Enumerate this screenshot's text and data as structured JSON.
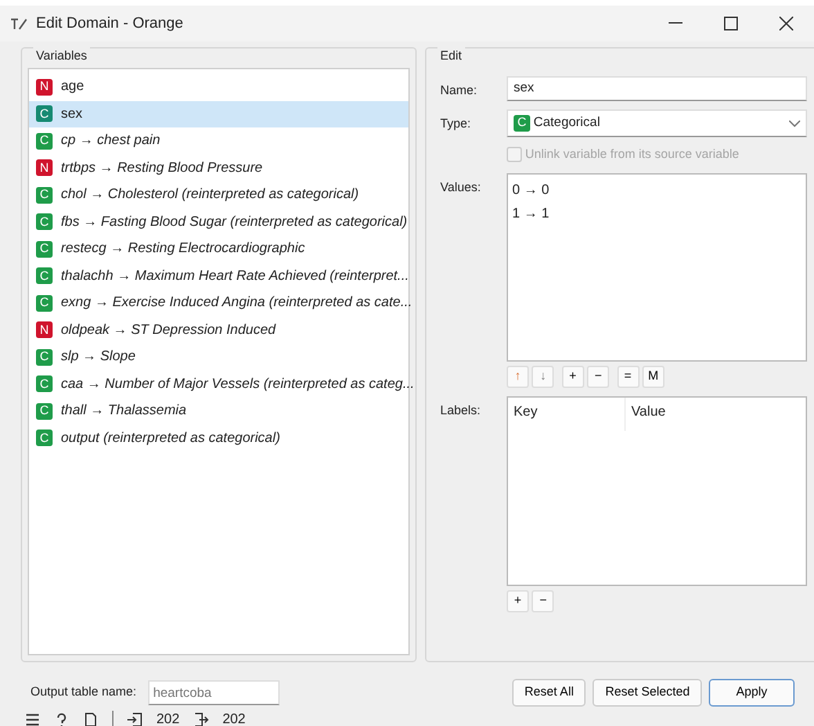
{
  "window": {
    "title": "Edit Domain - Orange"
  },
  "variables": {
    "title": "Variables",
    "items": [
      {
        "badge": "N",
        "kind": "numeric",
        "text": "age",
        "italic": false,
        "selected": false
      },
      {
        "badge": "C",
        "kind": "categorical",
        "text": "sex",
        "italic": false,
        "selected": true
      },
      {
        "badge": "C",
        "kind": "categorical",
        "text": "cp → chest pain",
        "italic": true,
        "selected": false
      },
      {
        "badge": "N",
        "kind": "numeric",
        "text": "trtbps → Resting Blood Pressure",
        "italic": true,
        "selected": false
      },
      {
        "badge": "C",
        "kind": "categorical",
        "text": "chol → Cholesterol (reinterpreted as categorical)",
        "italic": true,
        "selected": false
      },
      {
        "badge": "C",
        "kind": "categorical",
        "text": "fbs → Fasting Blood Sugar (reinterpreted as categorical)",
        "italic": true,
        "selected": false
      },
      {
        "badge": "C",
        "kind": "categorical",
        "text": "restecg → Resting Electrocardiographic",
        "italic": true,
        "selected": false
      },
      {
        "badge": "C",
        "kind": "categorical",
        "text": "thalachh → Maximum Heart Rate Achieved (reinterpret...",
        "italic": true,
        "selected": false
      },
      {
        "badge": "C",
        "kind": "categorical",
        "text": "exng → Exercise Induced Angina (reinterpreted as cate...",
        "italic": true,
        "selected": false
      },
      {
        "badge": "N",
        "kind": "numeric",
        "text": "oldpeak → ST Depression Induced",
        "italic": true,
        "selected": false
      },
      {
        "badge": "C",
        "kind": "categorical",
        "text": "slp → Slope",
        "italic": true,
        "selected": false
      },
      {
        "badge": "C",
        "kind": "categorical",
        "text": "caa → Number of Major Vessels (reinterpreted as categ...",
        "italic": true,
        "selected": false
      },
      {
        "badge": "C",
        "kind": "categorical",
        "text": "thall → Thalassemia",
        "italic": true,
        "selected": false
      },
      {
        "badge": "C",
        "kind": "categorical",
        "text": "output (reinterpreted as categorical)",
        "italic": true,
        "selected": false
      }
    ]
  },
  "edit": {
    "title": "Edit",
    "name_label": "Name:",
    "name_value": "sex",
    "type_label": "Type:",
    "type": {
      "badge": "C",
      "kind": "categorical",
      "label": "Categorical"
    },
    "unlink": {
      "label": "Unlink variable from its source variable",
      "checked": false,
      "disabled": true
    },
    "values_label": "Values:",
    "values": [
      "0 → 0",
      "1 → 1"
    ],
    "value_buttons": [
      "↑",
      "↓",
      "+",
      "−",
      "=",
      "M"
    ],
    "labels_label": "Labels:",
    "labels_columns": [
      "Key",
      "Value"
    ],
    "label_buttons": [
      "+",
      "−"
    ]
  },
  "footer": {
    "output_label": "Output table name:",
    "output_placeholder": "heartcoba",
    "buttons": [
      {
        "label": "Reset All",
        "default": false
      },
      {
        "label": "Reset Selected",
        "default": false
      },
      {
        "label": "Apply",
        "default": true
      }
    ]
  },
  "status_bar": {
    "input_count": "202",
    "output_count": "202"
  }
}
